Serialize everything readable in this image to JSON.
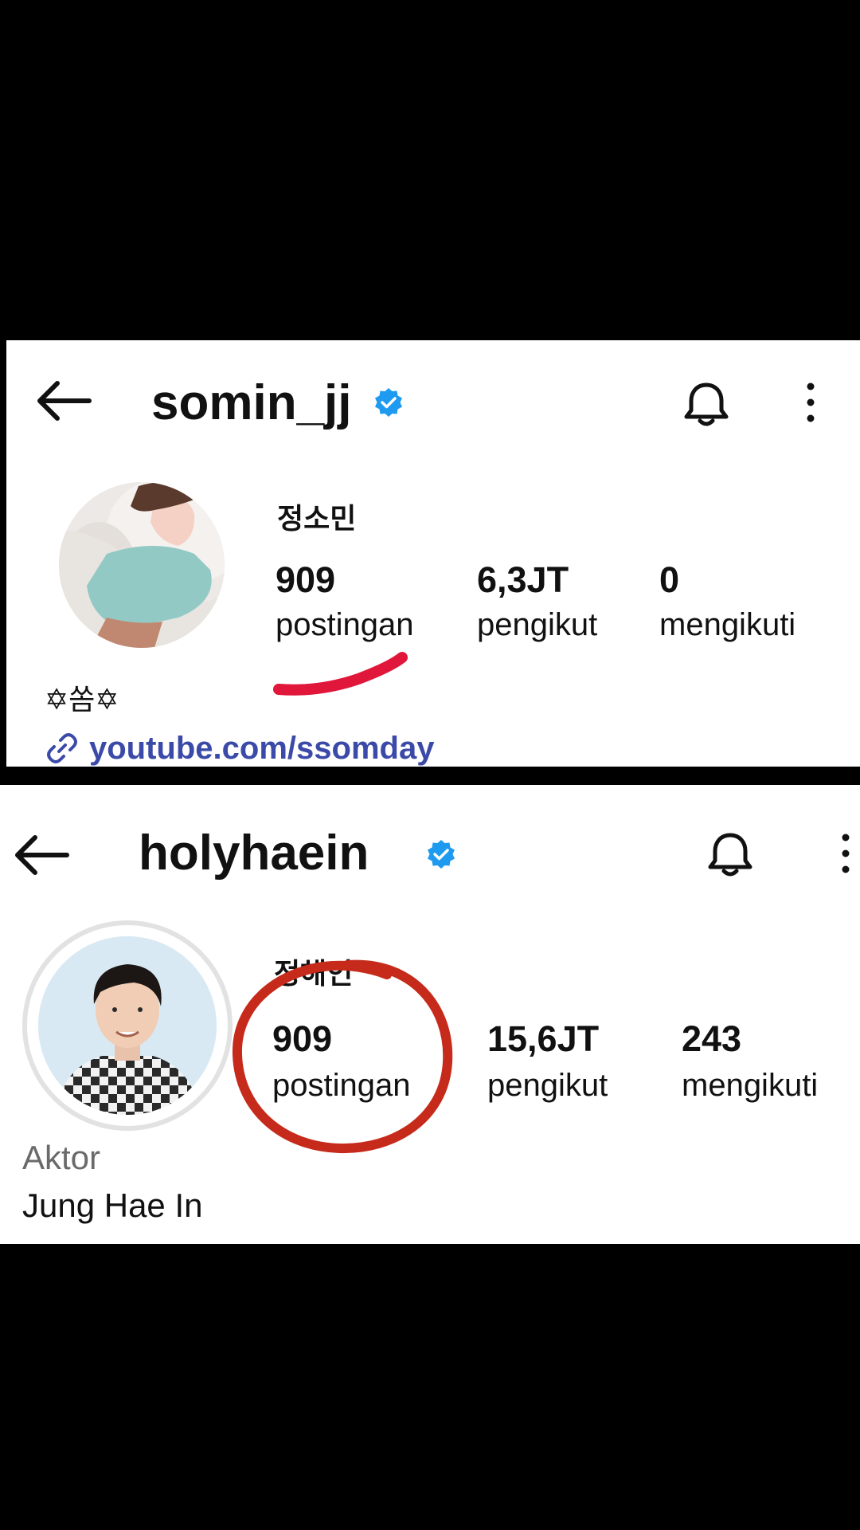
{
  "top_profile": {
    "username": "somin_jj",
    "display_name": "정소민",
    "stats": [
      {
        "count": "909",
        "label": "postingan"
      },
      {
        "count": "6,3JT",
        "label": "pengikut"
      },
      {
        "count": "0",
        "label": "mengikuti"
      }
    ],
    "bio": "✡쏨✡",
    "link": "youtube.com/ssomday",
    "avatar_icon": "profile-photo"
  },
  "bottom_profile": {
    "username": "holyhaein",
    "display_name": "정해인",
    "stats": [
      {
        "count": "909",
        "label": "postingan"
      },
      {
        "count": "15,6JT",
        "label": "pengikut"
      },
      {
        "count": "243",
        "label": "mengikuti"
      }
    ],
    "category": "Aktor",
    "bio": "Jung Hae In",
    "avatar_icon": "profile-photo"
  },
  "colors": {
    "verified_blue": "#1e9bf0",
    "link_blue": "#3b4aa8",
    "annotation_red": "#e0163a",
    "annotation_circle": "#c52a1a",
    "background": "#000000"
  }
}
